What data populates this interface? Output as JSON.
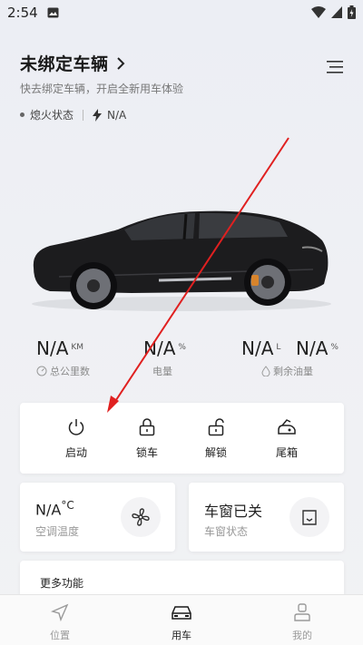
{
  "status_bar": {
    "time": "2:54"
  },
  "header": {
    "title": "未绑定车辆",
    "subtitle": "快去绑定车辆，开启全新用车体验",
    "ignition_status": "熄火状态",
    "charge_value": "N/A"
  },
  "metrics": [
    {
      "value": "N/A",
      "unit": "KM",
      "label": "总公里数",
      "icon": "odometer-icon"
    },
    {
      "value": "N/A",
      "unit": "%",
      "label": "电量",
      "icon": ""
    },
    {
      "value": "N/A",
      "unit": "L",
      "label": "剩余油量",
      "icon": "fuel-drop-icon"
    },
    {
      "value": "N/A",
      "unit": "%",
      "label": "",
      "icon": ""
    }
  ],
  "controls": [
    {
      "label": "启动",
      "icon": "power-icon"
    },
    {
      "label": "锁车",
      "icon": "lock-icon"
    },
    {
      "label": "解锁",
      "icon": "unlock-icon"
    },
    {
      "label": "尾箱",
      "icon": "trunk-icon"
    }
  ],
  "ac": {
    "value": "N/A",
    "unit": "°C",
    "label": "空调温度",
    "icon": "fan-icon"
  },
  "window": {
    "value": "车窗已关",
    "label": "车窗状态",
    "icon": "car-window-icon"
  },
  "more": {
    "title": "更多功能"
  },
  "bottom_nav": [
    {
      "label": "位置",
      "icon": "location-arrow-icon",
      "active": false
    },
    {
      "label": "用车",
      "icon": "car-icon",
      "active": true
    },
    {
      "label": "我的",
      "icon": "person-icon",
      "active": false
    }
  ],
  "colors": {
    "active": "#1a1a1a",
    "inactive": "#9a9a9a",
    "arrow": "#e02020"
  }
}
